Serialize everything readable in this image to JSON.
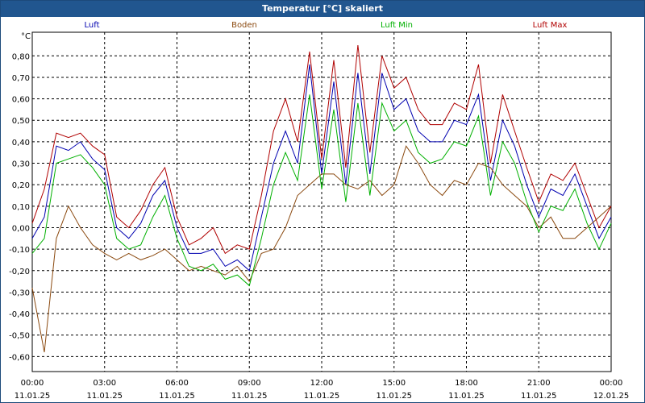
{
  "window": {
    "title": "Temperatur [°C] skaliert"
  },
  "chart_data": {
    "type": "line",
    "title": "Temperatur [°C] skaliert",
    "ylabel": "°C",
    "ylim": [
      -0.67,
      0.91
    ],
    "xlim": [
      0,
      24
    ],
    "yticks": [
      -0.6,
      -0.5,
      -0.4,
      -0.3,
      -0.2,
      -0.1,
      0.0,
      0.1,
      0.2,
      0.3,
      0.4,
      0.5,
      0.6,
      0.7,
      0.8
    ],
    "ytick_labels": [
      "-0,60",
      "-0,50",
      "-0,40",
      "-0,30",
      "-0,20",
      "-0,10",
      "0,00",
      "0,10",
      "0,20",
      "0,30",
      "0,40",
      "0,50",
      "0,60",
      "0,70",
      "0,80"
    ],
    "xticks": [
      0,
      3,
      6,
      9,
      12,
      15,
      18,
      21,
      24
    ],
    "xtick_time_labels": [
      "00:00",
      "03:00",
      "06:00",
      "09:00",
      "12:00",
      "15:00",
      "18:00",
      "21:00",
      "00:00"
    ],
    "xtick_date_labels": [
      "11.01.25",
      "11.01.25",
      "11.01.25",
      "11.01.25",
      "11.01.25",
      "11.01.25",
      "11.01.25",
      "11.01.25",
      "12.01.25"
    ],
    "grid": true,
    "legend_position": "top",
    "x": [
      0,
      0.5,
      1,
      1.5,
      2,
      2.5,
      3,
      3.5,
      4,
      4.5,
      5,
      5.5,
      6,
      6.5,
      7,
      7.5,
      8,
      8.5,
      9,
      9.5,
      10,
      10.5,
      11,
      11.5,
      12,
      12.5,
      13,
      13.5,
      14,
      14.5,
      15,
      15.5,
      16,
      16.5,
      17,
      17.5,
      18,
      18.5,
      19,
      19.5,
      20,
      20.5,
      21,
      21.5,
      22,
      22.5,
      23,
      23.5,
      24
    ],
    "series": [
      {
        "name": "Luft",
        "color": "#0000b0",
        "values": [
          -0.05,
          0.05,
          0.38,
          0.36,
          0.4,
          0.32,
          0.27,
          0.0,
          -0.05,
          0.02,
          0.15,
          0.22,
          0.0,
          -0.12,
          -0.12,
          -0.1,
          -0.18,
          -0.15,
          -0.2,
          0.05,
          0.3,
          0.45,
          0.3,
          0.76,
          0.25,
          0.68,
          0.2,
          0.72,
          0.25,
          0.72,
          0.55,
          0.6,
          0.45,
          0.4,
          0.4,
          0.5,
          0.48,
          0.62,
          0.22,
          0.5,
          0.38,
          0.2,
          0.05,
          0.18,
          0.15,
          0.25,
          0.1,
          -0.05,
          0.05
        ]
      },
      {
        "name": "Boden",
        "color": "#8b4a10",
        "values": [
          -0.28,
          -0.58,
          -0.05,
          0.1,
          0.0,
          -0.08,
          -0.12,
          -0.15,
          -0.12,
          -0.15,
          -0.13,
          -0.1,
          -0.15,
          -0.2,
          -0.18,
          -0.2,
          -0.22,
          -0.18,
          -0.25,
          -0.12,
          -0.1,
          0.0,
          0.15,
          0.2,
          0.25,
          0.25,
          0.2,
          0.18,
          0.22,
          0.15,
          0.2,
          0.38,
          0.3,
          0.2,
          0.15,
          0.22,
          0.2,
          0.3,
          0.28,
          0.2,
          0.15,
          0.1,
          0.0,
          0.05,
          -0.05,
          -0.05,
          0.0,
          0.05,
          0.1
        ]
      },
      {
        "name": "Luft Min",
        "color": "#00b000",
        "values": [
          -0.12,
          -0.05,
          0.3,
          0.32,
          0.34,
          0.28,
          0.2,
          -0.05,
          -0.1,
          -0.08,
          0.05,
          0.15,
          -0.05,
          -0.18,
          -0.2,
          -0.17,
          -0.24,
          -0.22,
          -0.27,
          -0.05,
          0.2,
          0.35,
          0.22,
          0.62,
          0.18,
          0.55,
          0.12,
          0.58,
          0.15,
          0.58,
          0.45,
          0.5,
          0.35,
          0.3,
          0.32,
          0.4,
          0.38,
          0.52,
          0.15,
          0.4,
          0.3,
          0.12,
          -0.02,
          0.1,
          0.08,
          0.18,
          0.02,
          -0.1,
          0.02
        ]
      },
      {
        "name": "Luft Max",
        "color": "#b00000",
        "values": [
          0.02,
          0.18,
          0.44,
          0.42,
          0.44,
          0.38,
          0.34,
          0.05,
          0.0,
          0.08,
          0.2,
          0.28,
          0.05,
          -0.08,
          -0.05,
          0.0,
          -0.12,
          -0.08,
          -0.1,
          0.15,
          0.45,
          0.6,
          0.4,
          0.82,
          0.32,
          0.78,
          0.28,
          0.85,
          0.35,
          0.8,
          0.65,
          0.7,
          0.55,
          0.48,
          0.48,
          0.58,
          0.55,
          0.76,
          0.3,
          0.62,
          0.45,
          0.28,
          0.12,
          0.25,
          0.22,
          0.3,
          0.15,
          0.0,
          0.1
        ]
      }
    ]
  }
}
